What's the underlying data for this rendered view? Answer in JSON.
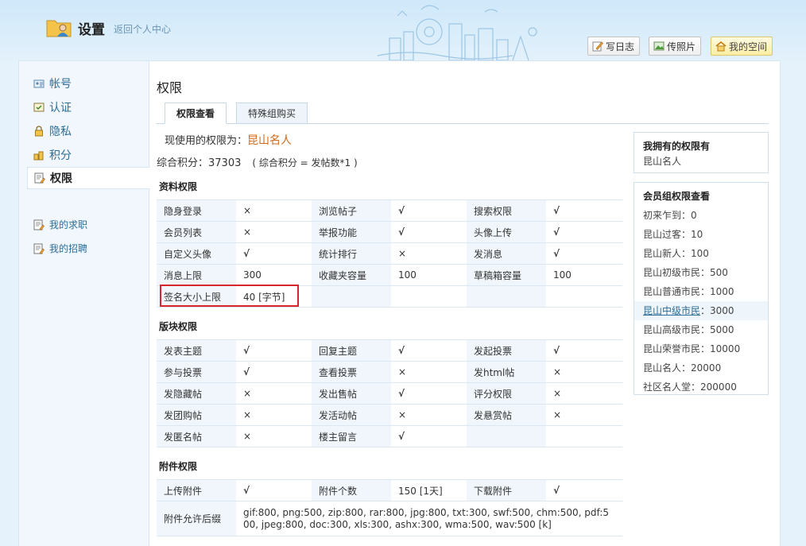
{
  "header": {
    "title": "设置",
    "back_link": "返回个人中心",
    "buttons": {
      "diary": "写日志",
      "photo": "传照片",
      "space": "我的空间"
    }
  },
  "sidebar": {
    "items": [
      {
        "label": "帐号",
        "icon": "id-card-icon"
      },
      {
        "label": "认证",
        "icon": "certify-icon"
      },
      {
        "label": "隐私",
        "icon": "lock-icon"
      },
      {
        "label": "积分",
        "icon": "coins-icon"
      },
      {
        "label": "权限",
        "icon": "permission-icon",
        "active": true
      }
    ],
    "sub_items": [
      {
        "label": "我的求职",
        "icon": "edit-icon"
      },
      {
        "label": "我的招聘",
        "icon": "edit-icon"
      }
    ]
  },
  "main": {
    "title": "权限",
    "tabs": [
      {
        "label": "权限查看",
        "active": true
      },
      {
        "label": "特殊组购买",
        "active": false
      }
    ],
    "current_perm_label": "现使用的权限为：",
    "current_perm_value": "昆山名人",
    "credit_label": "综合积分：",
    "credit_value": "37303",
    "credit_formula": "( 综合积分 = 发帖数*1 )"
  },
  "sections": {
    "profile": {
      "title": "资料权限",
      "rows": [
        [
          "隐身登录",
          "×",
          "浏览帖子",
          "√",
          "搜索权限",
          "√"
        ],
        [
          "会员列表",
          "×",
          "举报功能",
          "√",
          "头像上传",
          "√"
        ],
        [
          "自定义头像",
          "√",
          "统计排行",
          "×",
          "发消息",
          "√"
        ],
        [
          "消息上限",
          "300",
          "收藏夹容量",
          "100",
          "草稿箱容量",
          "100"
        ],
        [
          "签名大小上限",
          "40 [字节]",
          "",
          "",
          "",
          ""
        ]
      ]
    },
    "board": {
      "title": "版块权限",
      "rows": [
        [
          "发表主题",
          "√",
          "回复主题",
          "√",
          "发起投票",
          "√"
        ],
        [
          "参与投票",
          "√",
          "查看投票",
          "×",
          "发html帖",
          "×"
        ],
        [
          "发隐藏帖",
          "×",
          "发出售帖",
          "√",
          "评分权限",
          "×"
        ],
        [
          "发团购帖",
          "×",
          "发活动帖",
          "×",
          "发悬赏帖",
          "×"
        ],
        [
          "发匿名帖",
          "×",
          "楼主留言",
          "√",
          "",
          ""
        ]
      ]
    },
    "attach": {
      "title": "附件权限",
      "row1": [
        "上传附件",
        "√",
        "附件个数",
        "150 [1天]",
        "下载附件",
        "√"
      ],
      "ext_label": "附件允许后缀",
      "ext_value": "gif:800, png:500, zip:800, rar:800, jpg:800, txt:300, swf:500, chm:500, pdf:500, jpeg:800, doc:300, xls:300, ashx:300, wma:500, wav:500 [k]"
    }
  },
  "right": {
    "owned_title": "我拥有的权限有",
    "owned_value": "昆山名人",
    "groups_title": "会员组权限查看",
    "groups": [
      {
        "name": "初来乍到",
        "value": "0"
      },
      {
        "name": "昆山过客",
        "value": "10"
      },
      {
        "name": "昆山新人",
        "value": "100"
      },
      {
        "name": "昆山初级市民",
        "value": "500"
      },
      {
        "name": "昆山普通市民",
        "value": "1000"
      },
      {
        "name": "昆山中级市民",
        "value": "3000",
        "link": true
      },
      {
        "name": "昆山高级市民",
        "value": "5000"
      },
      {
        "name": "昆山荣誉市民",
        "value": "10000"
      },
      {
        "name": "昆山名人",
        "value": "20000"
      },
      {
        "name": "社区名人堂",
        "value": "200000"
      }
    ]
  }
}
